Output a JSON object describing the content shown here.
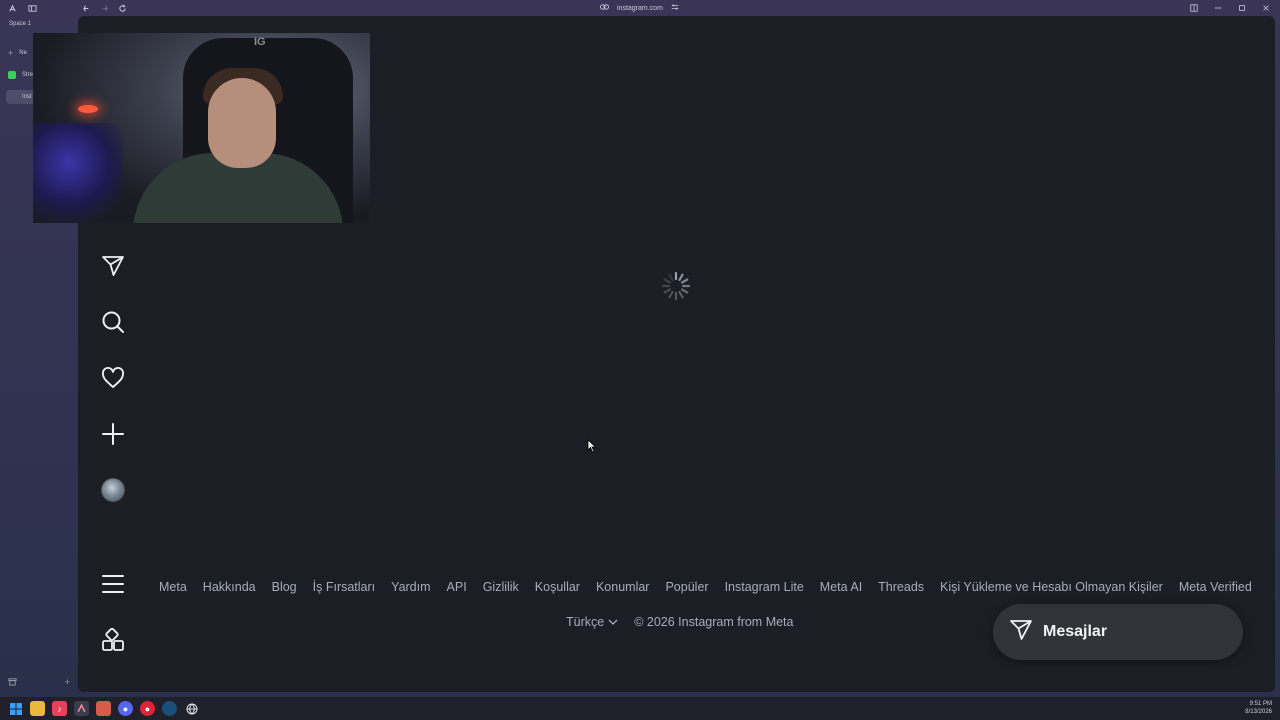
{
  "browser": {
    "url": "instagram.com",
    "space_label": "Space 1",
    "sidebar_items": [
      {
        "label": "Ne",
        "icon": "plus-icon"
      },
      {
        "label": "Stre",
        "icon": "stream-favicon"
      },
      {
        "label": "Inst",
        "icon": "instagram-favicon"
      }
    ]
  },
  "instagram": {
    "nav_icons": [
      "direct-send-icon",
      "search-icon",
      "heart-icon",
      "create-plus-icon",
      "profile-avatar",
      "menu-icon",
      "apps-icon"
    ],
    "footer_links": [
      "Meta",
      "Hakkında",
      "Blog",
      "İş Fırsatları",
      "Yardım",
      "API",
      "Gizlilik",
      "Koşullar",
      "Konumlar",
      "Popüler",
      "Instagram Lite",
      "Meta AI",
      "Threads",
      "Kişi Yükleme ve Hesabı Olmayan Kişiler",
      "Meta Verified"
    ],
    "language": "Türkçe",
    "copyright": "© 2026 Instagram from Meta",
    "messages_label": "Mesajlar"
  },
  "webcam_text": "IG",
  "taskbar": {
    "time": "9:51 PM",
    "date": "8/13/2026"
  },
  "colors": {
    "page_bg": "#1b1f25",
    "messages_bg": "#303338",
    "link_color": "#a8adb6"
  }
}
